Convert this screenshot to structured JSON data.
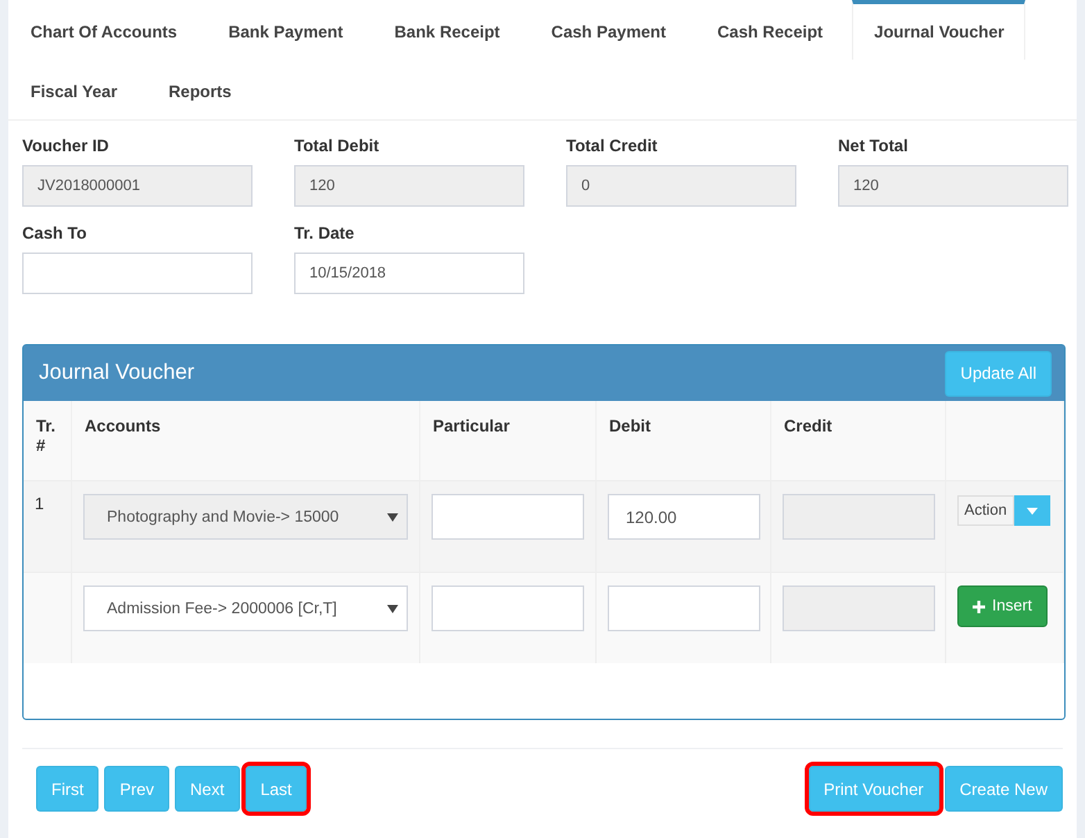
{
  "tabs": [
    {
      "label": "Chart Of Accounts",
      "selected": false
    },
    {
      "label": "Bank Payment",
      "selected": false
    },
    {
      "label": "Bank Receipt",
      "selected": false
    },
    {
      "label": "Cash Payment",
      "selected": false
    },
    {
      "label": "Cash Receipt",
      "selected": false
    },
    {
      "label": "Journal Voucher",
      "selected": true
    },
    {
      "label": "Fiscal Year",
      "selected": false
    },
    {
      "label": "Reports",
      "selected": false
    }
  ],
  "fields": [
    {
      "label": "Voucher ID",
      "value": "JV2018000001",
      "disabled": true
    },
    {
      "label": "Total Debit",
      "value": "120",
      "disabled": true
    },
    {
      "label": "Total Credit",
      "value": "0",
      "disabled": true
    },
    {
      "label": "Net Total",
      "value": "120",
      "disabled": true
    },
    {
      "label": "Cash To",
      "disabled": false
    },
    {
      "label": "Tr. Date",
      "value": "10/15/2018",
      "disabled": false
    }
  ],
  "voucher": {
    "title": "Journal Voucher",
    "update_button": "Update All",
    "columns": [
      "Tr. #",
      "Accounts",
      "Particular",
      "Debit",
      "Credit"
    ],
    "rows": [
      {
        "kind": "action",
        "tr": "1",
        "account": "Photography and Movie-> 15000",
        "account_disabled": true,
        "debit": "120.00",
        "action": "Action"
      },
      {
        "kind": "insert",
        "account": "Admission Fee-> 2000006 [Cr,T]",
        "account_disabled": false,
        "action": "Insert"
      }
    ]
  },
  "nav_buttons": [
    {
      "label": "First",
      "highlighted": false
    },
    {
      "label": "Prev",
      "highlighted": false
    },
    {
      "label": "Next",
      "highlighted": false
    },
    {
      "label": "Last",
      "highlighted": true
    }
  ],
  "action_buttons": [
    {
      "label": "Print Voucher",
      "highlighted": true
    },
    {
      "label": "Create New",
      "highlighted": false
    }
  ]
}
